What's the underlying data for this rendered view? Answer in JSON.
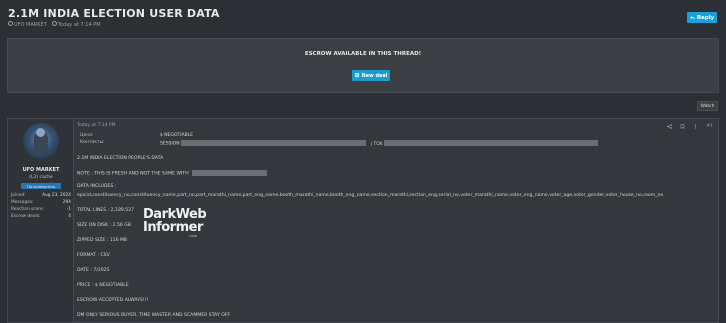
{
  "thread": {
    "title": "2.1M INDIA ELECTION USER DATA",
    "author": "UFO MARKET",
    "date": "Today at 7:14 PM"
  },
  "toolbar": {
    "reply_label": "Reply",
    "watch_label": "Watch"
  },
  "escrow": {
    "notice": "ESCROW AVAILABLE IN THIS THREAD!",
    "new_deal_label": "New deal"
  },
  "user": {
    "name": "UFO MARKET",
    "title": "(L3) cache",
    "banner": "Пользователь",
    "stats": [
      {
        "label": "Joined:",
        "value": "Aug 23, 2024"
      },
      {
        "label": "Messages:",
        "value": "294"
      },
      {
        "label": "Reaction score:",
        "value": "-1"
      },
      {
        "label": "Escrow deals:",
        "value": "4"
      }
    ]
  },
  "post": {
    "date": "Today at 7:14 PM",
    "number": "#1",
    "price_label": "Цена:",
    "price_value": "$ NEGOTIABLE",
    "contacts_label": "Контакты:",
    "contacts_session": "SESSION",
    "contacts_tox": "| TOX",
    "lines": [
      "2.1M INDIA ELECTION PEOPLE'S DATA",
      "NOTE : THIS IS FRESH AND NOT THE SAME WITH",
      "DATA INCLUDES :",
      "epicid,constituency_no,constituency_name,part_no,part_marathi_name,part_eng_name,booth_marathi_name,booth_eng_name,section_marathi,section_eng,serial_no,voter_marathi_name,voter_eng_name,voter_age,voter_gender,voter_house_no,room_no",
      "TOTAL LINES : 2,189,527",
      "SIZE ON DISK : 2.56 GB",
      "ZIPPED SIZE : 116 MB",
      "FORMAT : CSV",
      "DATE : 7/2025",
      "PRICE : $ NEGOTIABLE",
      "ESCROW ACCEPTED ALWAYS!!!",
      "DM ONLY SERIOUS BUYER, TIME WASTER AND SCAMMER STAY OFF"
    ]
  },
  "watermark": {
    "line1": "DarkWeb",
    "line2": "Informer",
    "line3": ".com"
  }
}
